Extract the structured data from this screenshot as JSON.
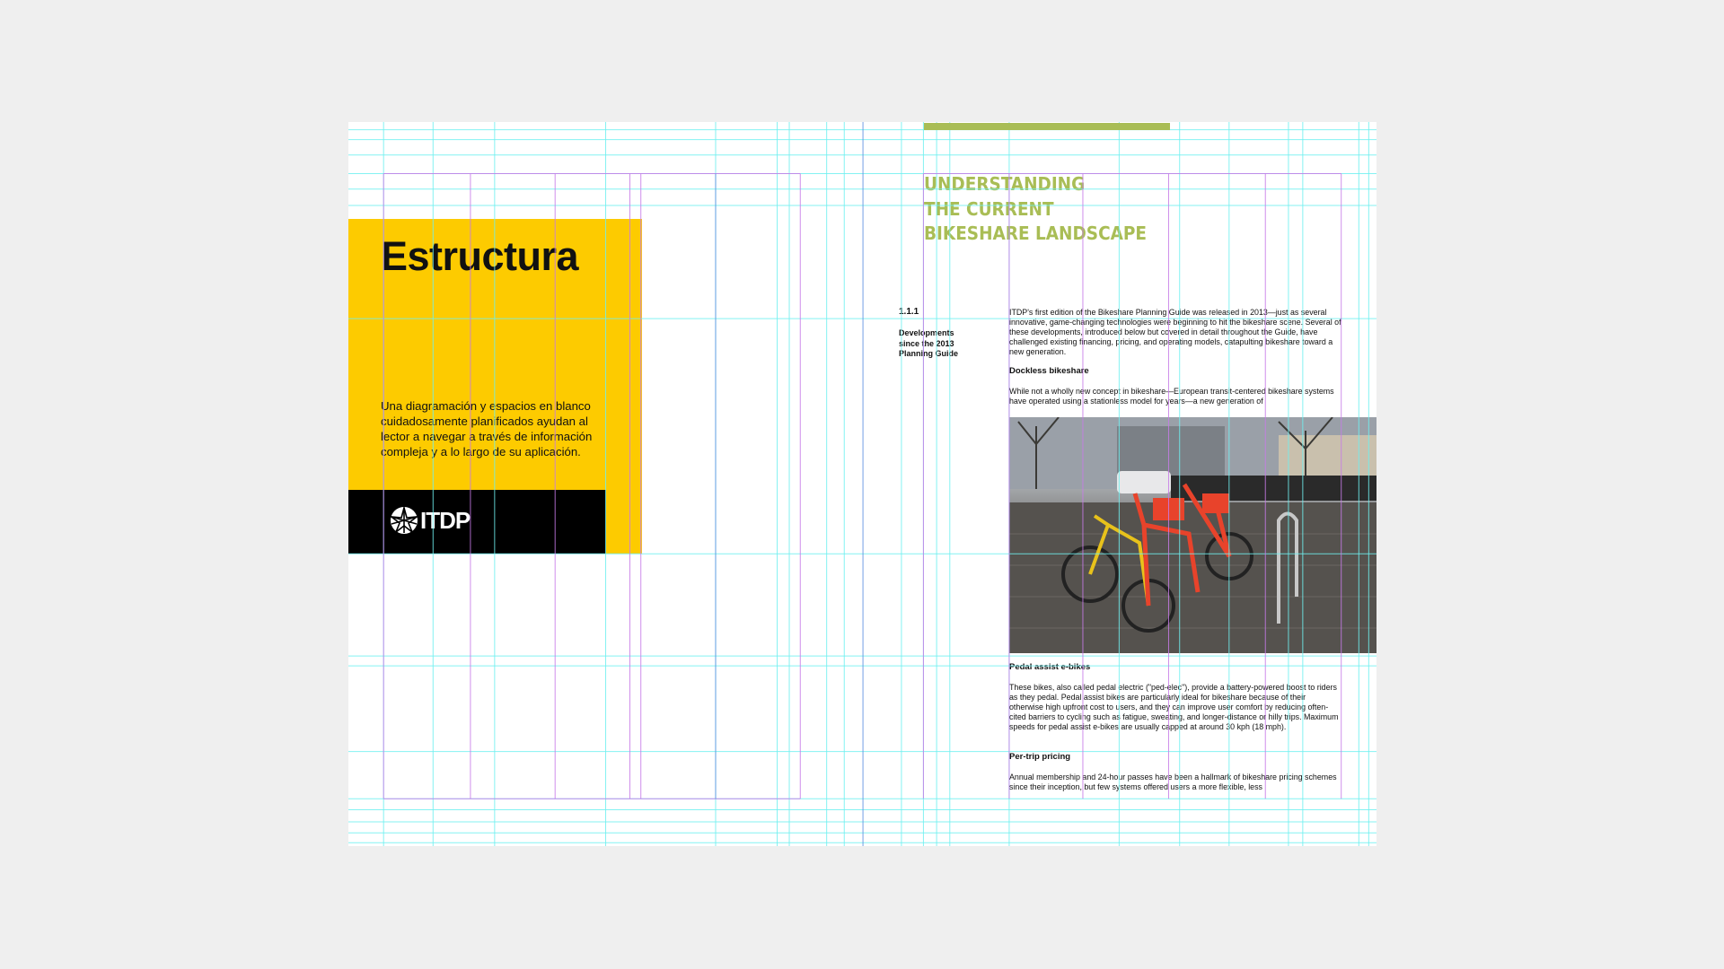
{
  "left_page": {
    "title": "Estructura",
    "intro": "Una diagramación y espacios en blanco cuidadosamente planificados ayudan al lector a navegar a través de información compleja y a lo largo de su aplicación.",
    "logo_text": "ITDP",
    "colors": {
      "yellow": "#fdcb00",
      "black": "#000000"
    }
  },
  "right_page": {
    "heading": [
      "UNDERSTANDING",
      "THE CURRENT",
      "BIKESHARE LANDSCAPE"
    ],
    "section_number": "1.1.1",
    "section_label": "Developments since the 2013 Planning Guide",
    "intro_paragraph": "ITDP's first edition of the Bikeshare Planning Guide was released in 2013—just as several innovative, game-changing technologies were beginning to hit the bikeshare scene. Several of these developments, introduced below but covered in detail throughout the Guide, have challenged existing financing, pricing, and operating models, catapulting bikeshare toward a new generation.",
    "sections": [
      {
        "title": "Dockless bikeshare",
        "text": "While not a wholly new concept in bikeshare—European transit-centered bikeshare systems have operated using a stationless model for years—a new generation of"
      },
      {
        "title": "Pedal assist e-bikes",
        "text": "These bikes, also called pedal electric (\"ped-elec\"), provide a battery-powered boost to riders as they pedal. Pedal assist bikes are particularly ideal for bikeshare because of their otherwise high upfront cost to users, and they can improve user comfort by reducing often-cited barriers to cycling such as fatigue, sweating, and longer-distance or hilly trips. Maximum speeds for pedal assist e-bikes are usually capped at around 30 kph (18 mph)."
      },
      {
        "title": "Per-trip pricing",
        "text": "Annual membership and 24-hour passes have been a hallmark of bikeshare pricing schemes since their inception, but few systems offered users a more flexible, less"
      }
    ],
    "colors": {
      "accent_green": "#a9bd55"
    }
  },
  "grid_colors": {
    "baseline": "#6ff0f0",
    "column": "#c77be8",
    "spine": "#5b8fe0"
  }
}
